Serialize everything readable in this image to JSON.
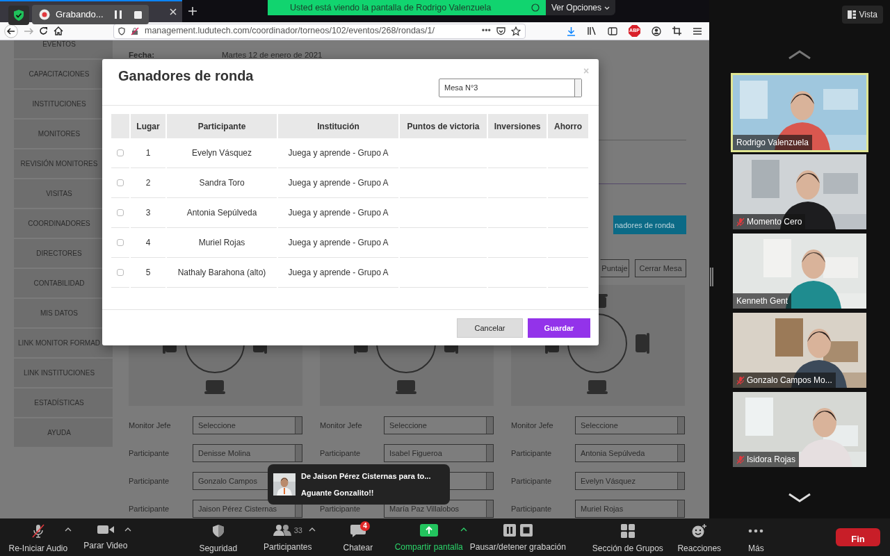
{
  "recording": {
    "label": "Grabando..."
  },
  "share_banner": {
    "text": "Usted está viendo la pantalla de Rodrigo Valenzuela",
    "options": "Ver Opciones"
  },
  "browser": {
    "url": "management.ludutech.com/coordinador/torneos/102/eventos/268/rondas/1/",
    "url_menu": "•••",
    "adblock": "ABP"
  },
  "sidebar": [
    "EVENTOS",
    "CAPACITACIONES",
    "INSTITUCIONES",
    "MONITORES",
    "REVISIÓN MONITORES",
    "VISITAS",
    "COORDINADORES",
    "DIRECTORES",
    "CONTABILIDAD",
    "MIS DATOS",
    "LINK MONITOR FORMAD",
    "LINK INSTITUCIONES",
    "ESTADÍSTICAS",
    "AYUDA"
  ],
  "event_info": {
    "label": "Fecha:",
    "value": "Martes 12 de enero de 2021"
  },
  "winners_button": "nadores de ronda",
  "table_actions": [
    "Puntaje",
    "Cerrar Mesa"
  ],
  "game_tables": [
    {
      "fields": [
        {
          "kind": "field",
          "label": "Monitor Jefe",
          "value": "Seleccione"
        },
        {
          "kind": "field",
          "label": "Participante",
          "value": "Denisse Molina"
        },
        {
          "kind": "field",
          "label": "Participante",
          "value": "Gonzalo Campos"
        },
        {
          "kind": "field",
          "label": "Participante",
          "value": "Jaison Pérez Cisternas"
        }
      ]
    },
    {
      "fields": [
        {
          "kind": "field",
          "label": "Monitor Jefe",
          "value": "Seleccione"
        },
        {
          "kind": "field",
          "label": "Participante",
          "value": "Isabel Figueroa"
        },
        {
          "kind": "covered"
        },
        {
          "kind": "field",
          "label": "Participante",
          "value": "María Paz Villalobos"
        }
      ]
    },
    {
      "fields": [
        {
          "kind": "field",
          "label": "Monitor Jefe",
          "value": "Seleccione"
        },
        {
          "kind": "field",
          "label": "Participante",
          "value": "Antonia Sepúlveda"
        },
        {
          "kind": "field",
          "label": "Participante",
          "value": "Evelyn Vásquez"
        },
        {
          "kind": "field",
          "label": "Participante",
          "value": "Muriel Rojas"
        }
      ]
    }
  ],
  "modal": {
    "title": "Ganadores de ronda",
    "select": "Mesa N°3",
    "close": "×",
    "columns": [
      "Lugar",
      "Participante",
      "Institución",
      "Puntos de victoria",
      "Inversiones",
      "Ahorro"
    ],
    "rows": [
      {
        "checked": false,
        "place": "1",
        "name": "Evelyn Vásquez",
        "institution": "Juega y aprende - Grupo A"
      },
      {
        "checked": false,
        "place": "2",
        "name": "Sandra Toro",
        "institution": "Juega y aprende - Grupo A"
      },
      {
        "checked": false,
        "place": "3",
        "name": "Antonia Sepúlveda",
        "institution": "Juega y aprende - Grupo A"
      },
      {
        "checked": false,
        "place": "4",
        "name": "Muriel Rojas",
        "institution": "Juega y aprende - Grupo A"
      },
      {
        "checked": false,
        "place": "5",
        "name": "Nathaly Barahona (alto)",
        "institution": "Juega y aprende - Grupo A"
      }
    ],
    "buttons": [
      {
        "label": "Cancelar",
        "kind": "secondary"
      },
      {
        "label": "Guardar",
        "kind": "primary"
      }
    ]
  },
  "chat_toast": {
    "sender": "De Jaison Pérez Cisternas para to...",
    "message": "Aguante Gonzalito!!"
  },
  "view_button": "Vista",
  "videos": [
    {
      "name": "Rodrigo Valenzuela",
      "muted": false,
      "speaking": true
    },
    {
      "name": "Momento Cero",
      "muted": true,
      "speaking": false
    },
    {
      "name": "Kenneth Gent",
      "muted": false,
      "speaking": false
    },
    {
      "name": "Gonzalo Campos Mo...",
      "muted": true,
      "speaking": false
    },
    {
      "name": "Isidora Rojas",
      "muted": true,
      "speaking": false
    }
  ],
  "toolbar": [
    {
      "kind": "mic-off",
      "label": "Re-Iniciar Audio",
      "caret": true,
      "active": false
    },
    {
      "kind": "video",
      "label": "Parar Video",
      "caret": true,
      "active": false
    },
    {
      "kind": "security",
      "label": "Seguridad",
      "caret": false,
      "active": false
    },
    {
      "kind": "participants",
      "label": "Participantes",
      "count": "33",
      "caret": true,
      "active": false
    },
    {
      "kind": "chat",
      "label": "Chatear",
      "badge": "4",
      "caret": false,
      "active": false
    },
    {
      "kind": "share",
      "label": "Compartir pantalla",
      "caret": true,
      "active": true
    },
    {
      "kind": "recording",
      "label": "Pausar/detener grabación",
      "caret": false,
      "active": false
    },
    {
      "kind": "breakout",
      "label": "Sección de Grupos",
      "caret": false,
      "active": false
    },
    {
      "kind": "reactions",
      "label": "Reacciones",
      "caret": false,
      "active": false
    },
    {
      "kind": "more",
      "label": "Más",
      "caret": false,
      "active": false
    }
  ],
  "end_button": "Fin"
}
